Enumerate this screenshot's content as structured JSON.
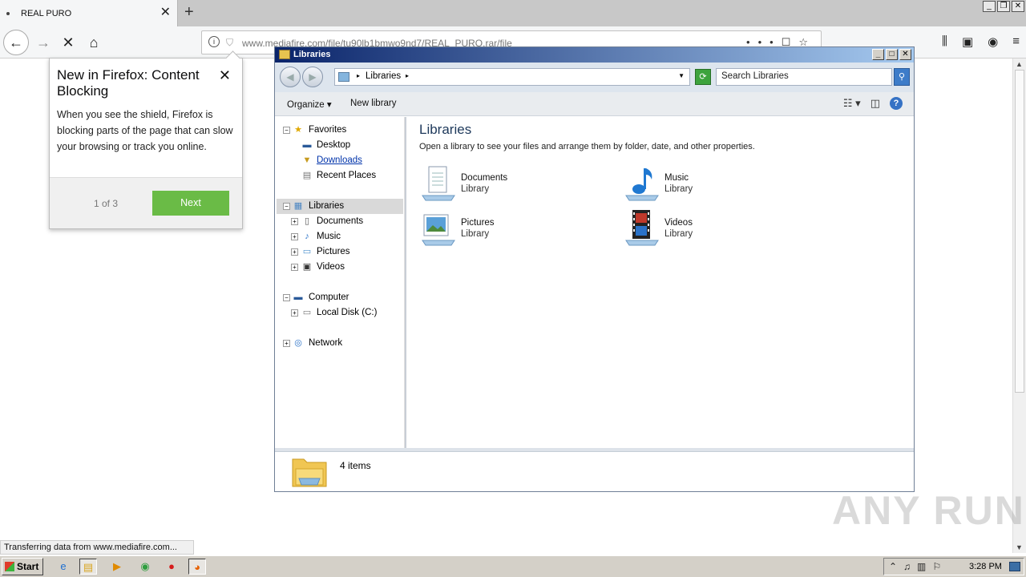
{
  "browser": {
    "tab": {
      "title": "REAL PURO"
    },
    "url": "www.mediafire.com/file/tu90lb1bmwo9nd7/REAL_PURO.rar/file",
    "status": "Transferring data from www.mediafire.com..."
  },
  "popup": {
    "title": "New in Firefox: Content Blocking",
    "body": "When you see the shield, Firefox is blocking parts of the page that can slow your browsing or track you online.",
    "pager": "1 of 3",
    "next_label": "Next",
    "accent": "#6abb46"
  },
  "explorer": {
    "title": "Libraries",
    "address": "Libraries",
    "search_placeholder": "Search Libraries",
    "toolbar": {
      "organize": "Organize",
      "new_library": "New library"
    },
    "nav": {
      "favorites": "Favorites",
      "desktop": "Desktop",
      "downloads": "Downloads",
      "recent": "Recent Places",
      "libraries": "Libraries",
      "documents": "Documents",
      "music": "Music",
      "pictures": "Pictures",
      "videos": "Videos",
      "computer": "Computer",
      "local_disk": "Local Disk (C:)",
      "network": "Network"
    },
    "main": {
      "heading": "Libraries",
      "subtitle": "Open a library to see your files and arrange them by folder, date, and other properties.",
      "items": [
        {
          "name": "Documents",
          "type": "Library"
        },
        {
          "name": "Music",
          "type": "Library"
        },
        {
          "name": "Pictures",
          "type": "Library"
        },
        {
          "name": "Videos",
          "type": "Library"
        }
      ]
    },
    "status": "4 items"
  },
  "taskbar": {
    "start": "Start",
    "clock": "3:28 PM"
  },
  "watermark": "ANY RUN"
}
